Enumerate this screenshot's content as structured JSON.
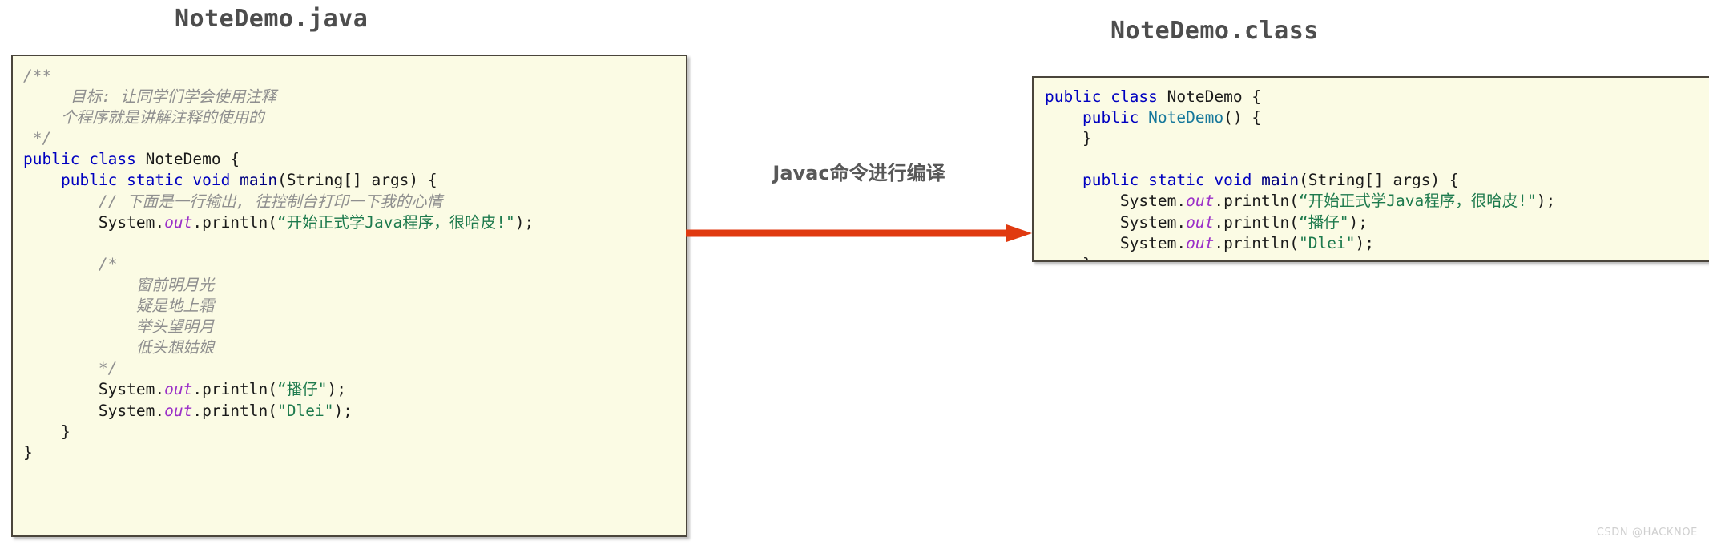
{
  "titles": {
    "left": "NoteDemo.java",
    "right": "NoteDemo.class"
  },
  "arrow": {
    "label": "Javac命令进行编译",
    "color": "#e03a10",
    "direction": "left-to-right"
  },
  "watermark": "CSDN @HACKNOE",
  "colors": {
    "panel_background": "#fbfbe4",
    "panel_border": "#4a453b",
    "keyword": "#0000c0",
    "method": "#000080",
    "constructor": "#16789b",
    "string": "#1d7a4d",
    "comment": "#8f8f8f",
    "field": "#9b30c8",
    "title": "#4d4d4d",
    "arrow": "#e03a10"
  },
  "source_panel": {
    "filename": "NoteDemo.java",
    "lines": [
      {
        "indent": 0,
        "tokens": [
          {
            "t": "/**",
            "c": "cmt"
          }
        ]
      },
      {
        "indent": 0,
        "tokens": [
          {
            "t": "     目标: 让同学们学会使用注释",
            "c": "cmt"
          }
        ]
      },
      {
        "indent": 0,
        "tokens": [
          {
            "t": "    个程序就是讲解注释的使用的",
            "c": "cmt"
          }
        ]
      },
      {
        "indent": 0,
        "tokens": [
          {
            "t": " */",
            "c": "cmt"
          }
        ]
      },
      {
        "indent": 0,
        "tokens": [
          {
            "t": "public",
            "c": "kw"
          },
          {
            "t": " ",
            "c": "plain"
          },
          {
            "t": "class",
            "c": "kw"
          },
          {
            "t": " NoteDemo {",
            "c": "plain"
          }
        ]
      },
      {
        "indent": 0,
        "tokens": [
          {
            "t": "    ",
            "c": "plain"
          },
          {
            "t": "public",
            "c": "kw"
          },
          {
            "t": " ",
            "c": "plain"
          },
          {
            "t": "static",
            "c": "kw"
          },
          {
            "t": " ",
            "c": "plain"
          },
          {
            "t": "void",
            "c": "kw"
          },
          {
            "t": " ",
            "c": "plain"
          },
          {
            "t": "main",
            "c": "mth"
          },
          {
            "t": "(String[] args) {",
            "c": "plain"
          }
        ]
      },
      {
        "indent": 0,
        "tokens": [
          {
            "t": "        // 下面是一行输出, 往控制台打印一下我的心情",
            "c": "cmt"
          }
        ]
      },
      {
        "indent": 0,
        "tokens": [
          {
            "t": "        System.",
            "c": "plain"
          },
          {
            "t": "out",
            "c": "fld"
          },
          {
            "t": ".println(",
            "c": "plain"
          },
          {
            "t": "“开始正式学Java程序，很哈皮!\"",
            "c": "str"
          },
          {
            "t": ");",
            "c": "plain"
          }
        ]
      },
      {
        "indent": 0,
        "tokens": [
          {
            "t": "",
            "c": "plain"
          }
        ]
      },
      {
        "indent": 0,
        "tokens": [
          {
            "t": "        /*",
            "c": "cmt"
          }
        ]
      },
      {
        "indent": 0,
        "tokens": [
          {
            "t": "            窗前明月光",
            "c": "cmt"
          }
        ]
      },
      {
        "indent": 0,
        "tokens": [
          {
            "t": "            疑是地上霜",
            "c": "cmt"
          }
        ]
      },
      {
        "indent": 0,
        "tokens": [
          {
            "t": "            举头望明月",
            "c": "cmt"
          }
        ]
      },
      {
        "indent": 0,
        "tokens": [
          {
            "t": "            低头想姑娘",
            "c": "cmt"
          }
        ]
      },
      {
        "indent": 0,
        "tokens": [
          {
            "t": "        */",
            "c": "cmt"
          }
        ]
      },
      {
        "indent": 0,
        "tokens": [
          {
            "t": "        System.",
            "c": "plain"
          },
          {
            "t": "out",
            "c": "fld"
          },
          {
            "t": ".println(",
            "c": "plain"
          },
          {
            "t": "“播仔\"",
            "c": "str"
          },
          {
            "t": ");",
            "c": "plain"
          }
        ]
      },
      {
        "indent": 0,
        "tokens": [
          {
            "t": "        System.",
            "c": "plain"
          },
          {
            "t": "out",
            "c": "fld"
          },
          {
            "t": ".println(",
            "c": "plain"
          },
          {
            "t": "\"Dlei\"",
            "c": "str"
          },
          {
            "t": ");",
            "c": "plain"
          }
        ]
      },
      {
        "indent": 0,
        "tokens": [
          {
            "t": "    }",
            "c": "plain"
          }
        ]
      },
      {
        "indent": 0,
        "tokens": [
          {
            "t": "}",
            "c": "plain"
          }
        ]
      }
    ]
  },
  "class_panel": {
    "filename": "NoteDemo.class",
    "lines": [
      {
        "indent": 0,
        "tokens": [
          {
            "t": "public",
            "c": "kw"
          },
          {
            "t": " ",
            "c": "plain"
          },
          {
            "t": "class",
            "c": "kw"
          },
          {
            "t": " NoteDemo {",
            "c": "plain"
          }
        ]
      },
      {
        "indent": 0,
        "tokens": [
          {
            "t": "    ",
            "c": "plain"
          },
          {
            "t": "public",
            "c": "kw"
          },
          {
            "t": " ",
            "c": "plain"
          },
          {
            "t": "NoteDemo",
            "c": "ctor"
          },
          {
            "t": "() {",
            "c": "plain"
          }
        ]
      },
      {
        "indent": 0,
        "tokens": [
          {
            "t": "    }",
            "c": "plain"
          }
        ]
      },
      {
        "indent": 0,
        "tokens": [
          {
            "t": "",
            "c": "plain"
          }
        ]
      },
      {
        "indent": 0,
        "tokens": [
          {
            "t": "    ",
            "c": "plain"
          },
          {
            "t": "public",
            "c": "kw"
          },
          {
            "t": " ",
            "c": "plain"
          },
          {
            "t": "static",
            "c": "kw"
          },
          {
            "t": " ",
            "c": "plain"
          },
          {
            "t": "void",
            "c": "kw"
          },
          {
            "t": " ",
            "c": "plain"
          },
          {
            "t": "main",
            "c": "mth"
          },
          {
            "t": "(String[] args) {",
            "c": "plain"
          }
        ]
      },
      {
        "indent": 0,
        "tokens": [
          {
            "t": "        System.",
            "c": "plain"
          },
          {
            "t": "out",
            "c": "fld"
          },
          {
            "t": ".println(",
            "c": "plain"
          },
          {
            "t": "“开始正式学Java程序，很哈皮!\"",
            "c": "str"
          },
          {
            "t": ");",
            "c": "plain"
          }
        ]
      },
      {
        "indent": 0,
        "tokens": [
          {
            "t": "        System.",
            "c": "plain"
          },
          {
            "t": "out",
            "c": "fld"
          },
          {
            "t": ".println(",
            "c": "plain"
          },
          {
            "t": "“播仔\"",
            "c": "str"
          },
          {
            "t": ");",
            "c": "plain"
          }
        ]
      },
      {
        "indent": 0,
        "tokens": [
          {
            "t": "        System.",
            "c": "plain"
          },
          {
            "t": "out",
            "c": "fld"
          },
          {
            "t": ".println(",
            "c": "plain"
          },
          {
            "t": "\"Dlei\"",
            "c": "str"
          },
          {
            "t": ");",
            "c": "plain"
          }
        ]
      },
      {
        "indent": 0,
        "tokens": [
          {
            "t": "    }",
            "c": "plain"
          }
        ]
      },
      {
        "indent": 0,
        "tokens": [
          {
            "t": "}",
            "c": "plain"
          }
        ]
      }
    ]
  }
}
